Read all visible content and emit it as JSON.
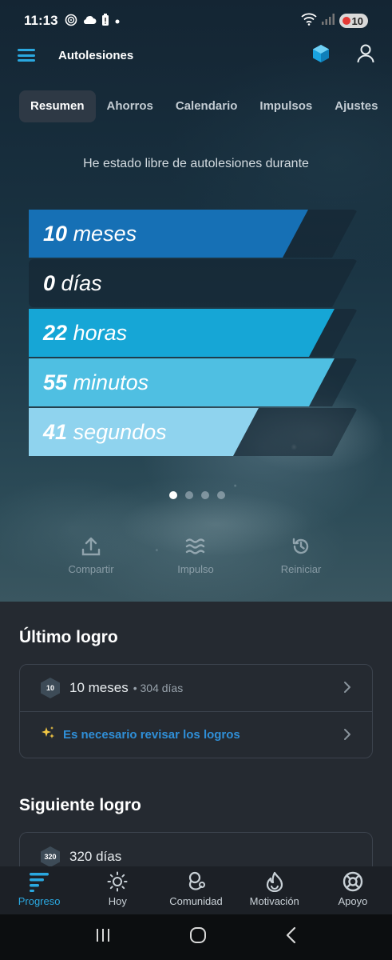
{
  "status_bar": {
    "time": "11:13",
    "battery": "10"
  },
  "header": {
    "title": "Autolesiones",
    "accent_color": "#2aa8e0"
  },
  "tabs": [
    {
      "label": "Resumen",
      "active": true
    },
    {
      "label": "Ahorros",
      "active": false
    },
    {
      "label": "Calendario",
      "active": false
    },
    {
      "label": "Impulsos",
      "active": false
    },
    {
      "label": "Ajustes",
      "active": false
    }
  ],
  "hero": {
    "subtitle": "He estado libre de autolesiones durante",
    "counters": [
      {
        "value": "10",
        "unit": "meses",
        "fill_fraction": 0.85,
        "color": "#1670b5"
      },
      {
        "value": "0",
        "unit": "días",
        "fill_fraction": 0.0,
        "color": "#1688c6"
      },
      {
        "value": "22",
        "unit": "horas",
        "fill_fraction": 0.93,
        "color": "#16a6d6"
      },
      {
        "value": "55",
        "unit": "minutos",
        "fill_fraction": 0.93,
        "color": "#4fbfe2"
      },
      {
        "value": "41",
        "unit": "segundos",
        "fill_fraction": 0.7,
        "color": "#8fd3ee"
      }
    ],
    "pager": {
      "count": 4,
      "active_index": 0
    },
    "actions": [
      {
        "label": "Compartir",
        "icon": "share-icon"
      },
      {
        "label": "Impulso",
        "icon": "waves-icon"
      },
      {
        "label": "Reiniciar",
        "icon": "history-icon"
      }
    ]
  },
  "last_achievement": {
    "title": "Último logro",
    "badge": "10",
    "main": "10 meses",
    "sub": "• 304 días",
    "review_icon": "sparkles-icon",
    "review_label": "Es necesario revisar los logros"
  },
  "next_achievement": {
    "title": "Siguiente logro",
    "badge": "320",
    "main": "320 días"
  },
  "bottom_nav": [
    {
      "label": "Progreso",
      "icon": "progress-icon",
      "active": true
    },
    {
      "label": "Hoy",
      "icon": "sun-icon",
      "active": false
    },
    {
      "label": "Comunidad",
      "icon": "community-icon",
      "active": false
    },
    {
      "label": "Motivación",
      "icon": "flame-icon",
      "active": false
    },
    {
      "label": "Apoyo",
      "icon": "lifebuoy-icon",
      "active": false
    }
  ]
}
